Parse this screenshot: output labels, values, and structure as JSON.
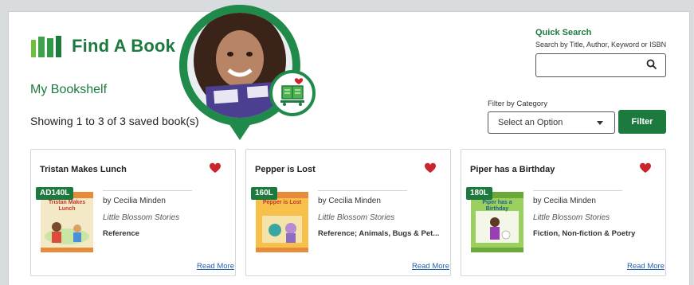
{
  "header": {
    "logo_text": "Find A Book"
  },
  "shelf": {
    "title": "My Bookshelf",
    "showing": "Showing 1 to 3 of 3 saved book(s)"
  },
  "quick_search": {
    "title": "Quick Search",
    "subtitle": "Search by Title, Author, Keyword or ISBN",
    "value": ""
  },
  "filter": {
    "label": "Filter by Category",
    "selected": "Select an Option",
    "button": "Filter"
  },
  "books": [
    {
      "title": "Tristan Makes Lunch",
      "level": "AD140L",
      "cover_title": "Tristan Makes Lunch",
      "author": "by Cecilia Minden",
      "series": "Little Blossom Stories",
      "category": "Reference",
      "read_more": "Read More"
    },
    {
      "title": "Pepper is Lost",
      "level": "160L",
      "cover_title": "Pepper is Lost",
      "author": "by Cecilia Minden",
      "series": "Little Blossom Stories",
      "category": "Reference; Animals, Bugs & Pet...",
      "read_more": "Read More"
    },
    {
      "title": "Piper has a Birthday",
      "level": "180L",
      "cover_title": "Piper has a Birthday",
      "author": "by Cecilia Minden",
      "series": "Little Blossom Stories",
      "category": "Fiction, Non-fiction & Poetry",
      "read_more": "Read More"
    }
  ],
  "icons": {
    "logo": "books-logo-icon",
    "search": "search-icon",
    "favorite": "heart-icon",
    "badge": "bookshelf-icon"
  },
  "colors": {
    "brand_green": "#1d7a3f",
    "heart_red": "#c8252c",
    "link_blue": "#1f5fae"
  }
}
